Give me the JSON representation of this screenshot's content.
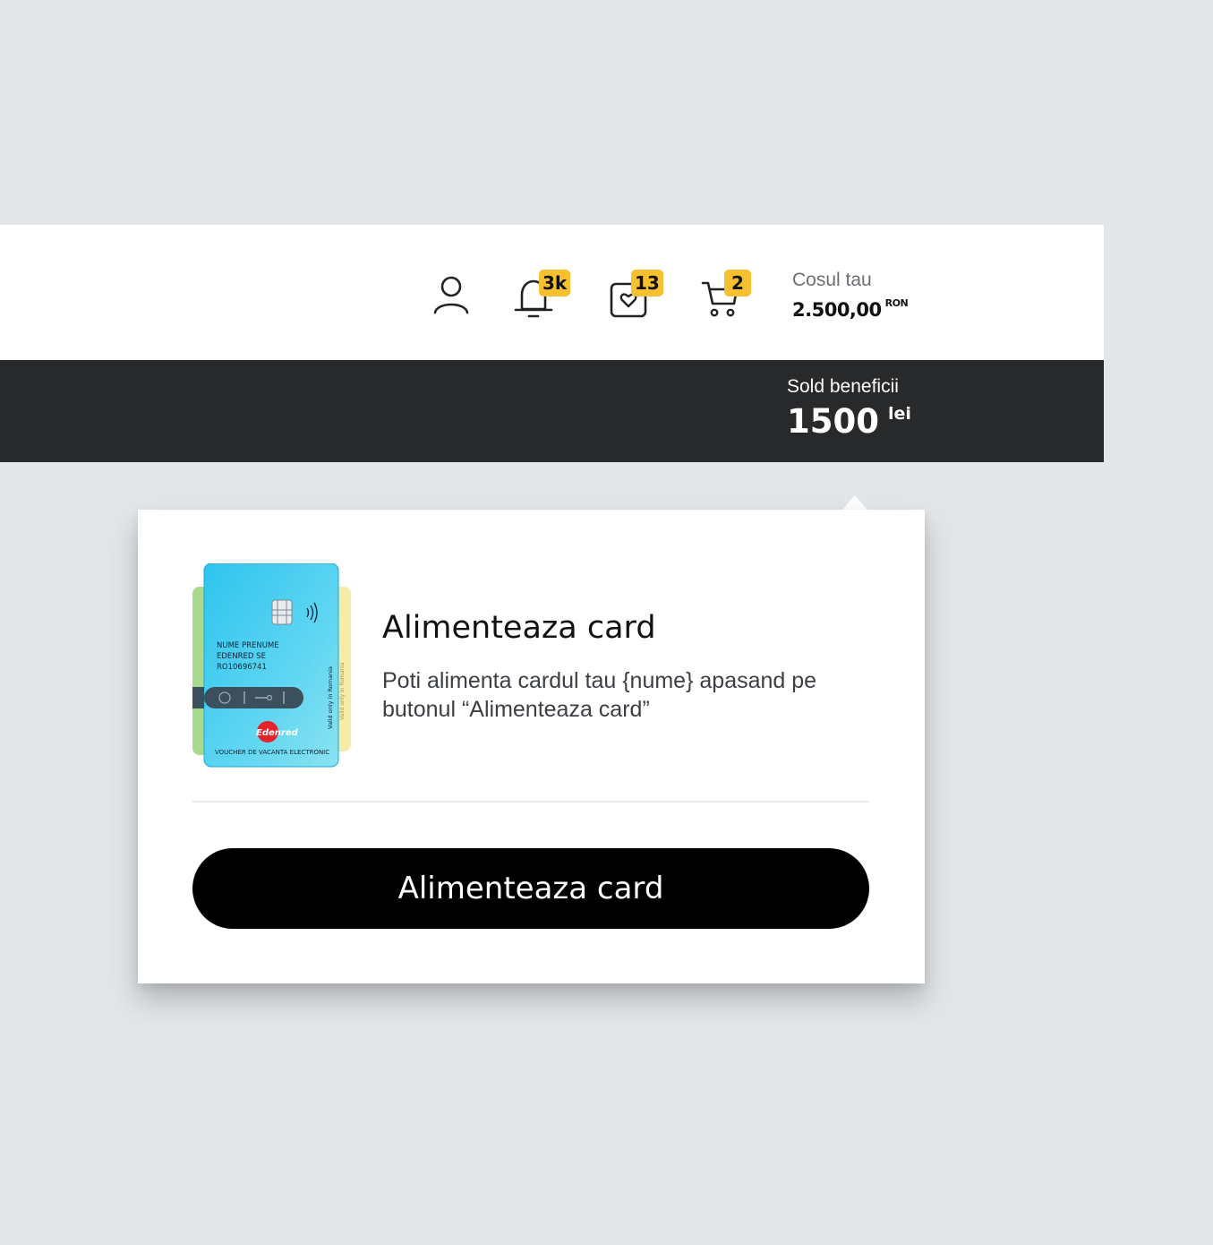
{
  "header": {
    "icons": [
      {
        "name": "user-icon"
      },
      {
        "name": "bell-icon",
        "badge": "3k"
      },
      {
        "name": "heart-bag-icon",
        "badge": "13"
      },
      {
        "name": "cart-icon",
        "badge": "2"
      }
    ],
    "cart_label": "Cosul tau",
    "cart_total": "2.500,00",
    "cart_currency": "RON"
  },
  "benefits_bar": {
    "label": "Sold beneficii",
    "value": "1500",
    "unit": "lei"
  },
  "popover": {
    "title": "Alimenteaza card",
    "description": "Poti alimenta cardul tau {nume} apasand pe butonul “Alimenteaza card”",
    "button_label": "Alimenteaza card",
    "card": {
      "holder_name": "NUME PRENUME",
      "company": "EDENRED SE",
      "code": "RO10696741",
      "brand": "Edenred",
      "type_label": "VOUCHER DE VACANTA ELECTRONIC",
      "side_text": "Valid only in Romania",
      "colors": {
        "front": "#3ec8ec",
        "back_left": "#a8d98f",
        "back_right": "#f5eca8",
        "brand_red": "#e4232a"
      }
    }
  },
  "colors": {
    "badge": "#f7c02f",
    "dark_bar": "#28292b",
    "background": "#e3e6e9"
  }
}
